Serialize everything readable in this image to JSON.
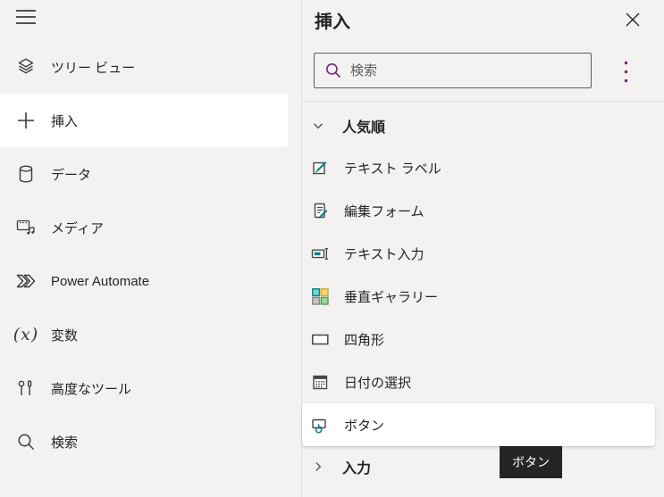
{
  "colors": {
    "background": "#f3f2f1",
    "selection_white": "#ffffff",
    "divider": "#e1dfdd",
    "text": "#252423",
    "placeholder": "#605e5c",
    "brand_purple": "#742774",
    "accent_teal": "#038387",
    "tooltip_bg": "#252423"
  },
  "sidebar": {
    "menu_icon": "hamburger-icon",
    "items": [
      {
        "label": "ツリー ビュー",
        "icon": "tree-view-icon",
        "selected": false
      },
      {
        "label": "挿入",
        "icon": "insert-plus-icon",
        "selected": true
      },
      {
        "label": "データ",
        "icon": "database-icon",
        "selected": false
      },
      {
        "label": "メディア",
        "icon": "media-icon",
        "selected": false
      },
      {
        "label": "Power Automate",
        "icon": "power-automate-icon",
        "selected": false
      },
      {
        "label": "変数",
        "icon": "variables-icon",
        "selected": false
      },
      {
        "label": "高度なツール",
        "icon": "advanced-tools-icon",
        "selected": false
      },
      {
        "label": "検索",
        "icon": "search-icon",
        "selected": false
      }
    ]
  },
  "insert_panel": {
    "title": "挿入",
    "close_icon": "close-icon",
    "search": {
      "placeholder": "検索",
      "icon": "search-icon"
    },
    "more_icon": "kebab-menu-icon",
    "popular_section": {
      "label": "人気順",
      "expanded": true,
      "icon": "chevron-down-icon"
    },
    "items": [
      {
        "label": "テキスト ラベル",
        "icon": "text-label-icon",
        "hovered": false
      },
      {
        "label": "編集フォーム",
        "icon": "edit-form-icon",
        "hovered": false
      },
      {
        "label": "テキスト入力",
        "icon": "text-input-icon",
        "hovered": false
      },
      {
        "label": "垂直ギャラリー",
        "icon": "vertical-gallery-icon",
        "hovered": false
      },
      {
        "label": "四角形",
        "icon": "rectangle-icon",
        "hovered": false
      },
      {
        "label": "日付の選択",
        "icon": "date-picker-icon",
        "hovered": false
      },
      {
        "label": "ボタン",
        "icon": "button-icon",
        "hovered": true
      }
    ],
    "input_section": {
      "label": "入力",
      "expanded": false,
      "icon": "chevron-right-icon"
    },
    "tooltip": {
      "text": "ボタン"
    }
  }
}
